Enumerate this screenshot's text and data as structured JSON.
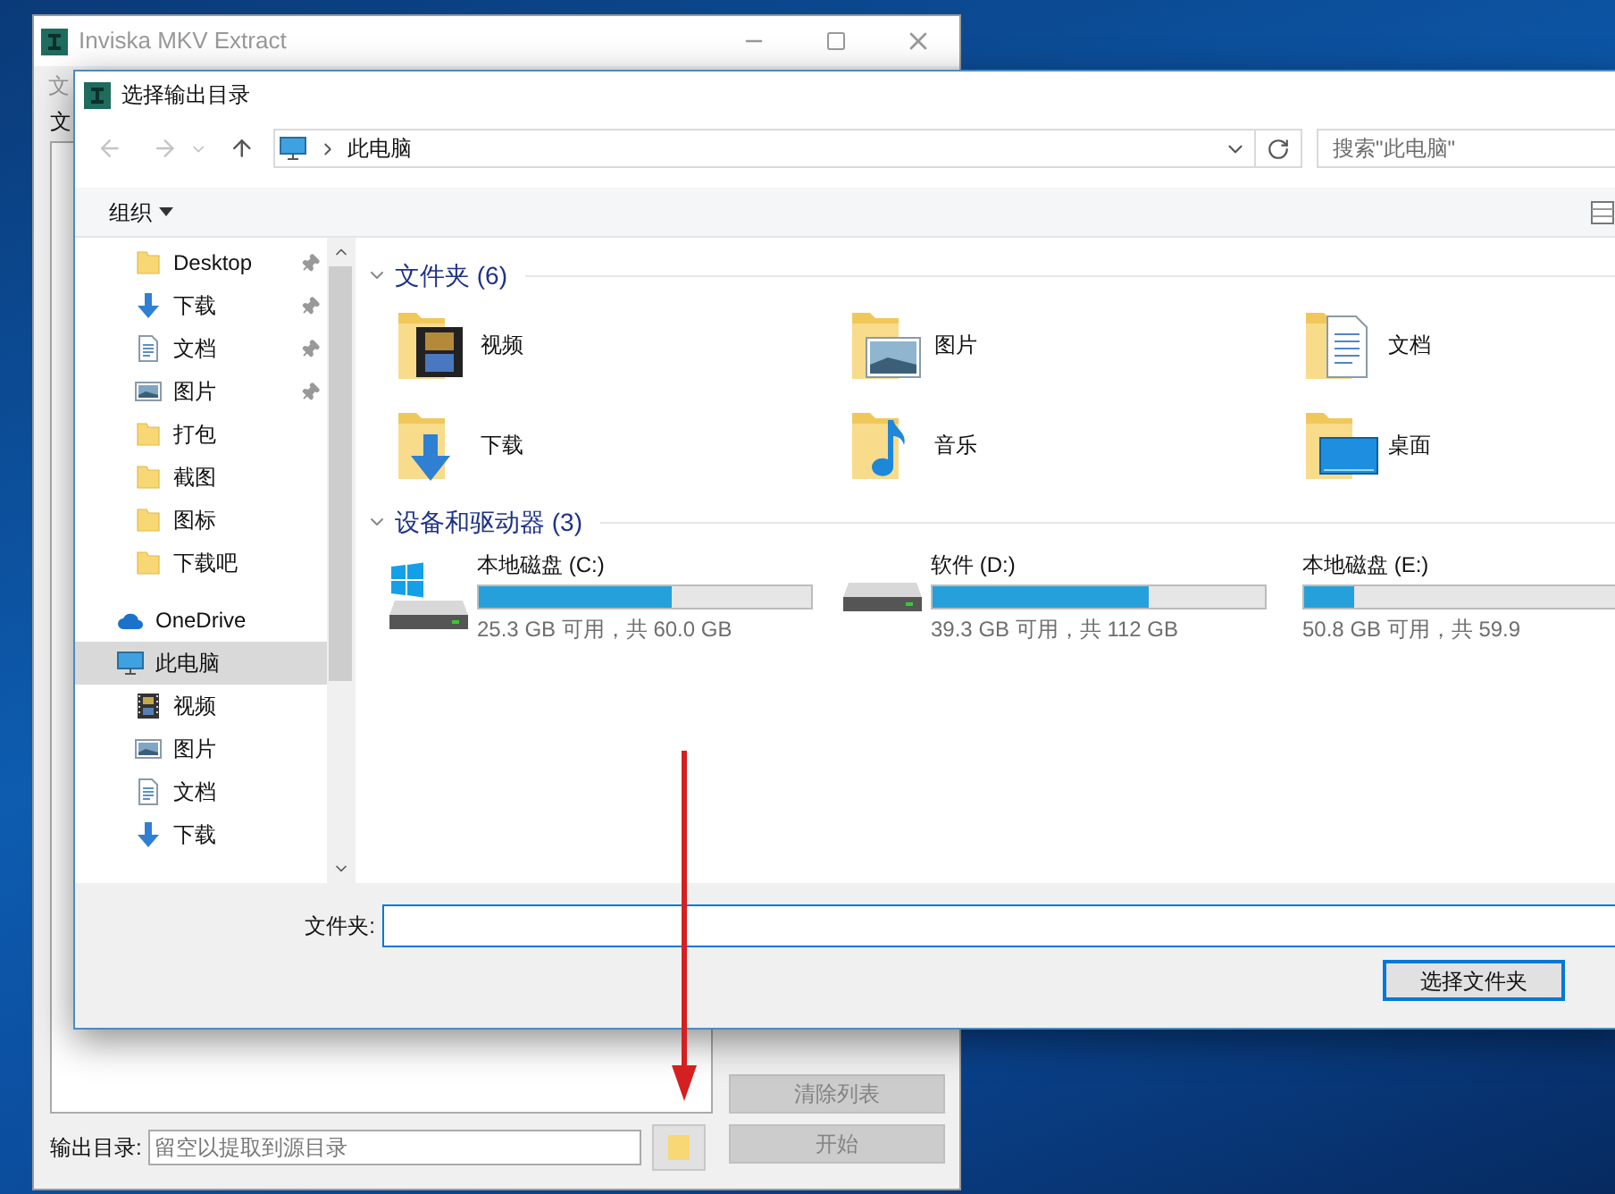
{
  "back_window": {
    "title": "Inviska MKV Extract",
    "menu": [
      {
        "label": "文"
      }
    ],
    "files_label": "文",
    "clear_button": {
      "label": "清除列表",
      "disabled": true
    },
    "start_button": {
      "label": "开始",
      "disabled": true
    },
    "output": {
      "label": "输出目录:",
      "placeholder": "留空以提取到源目录"
    }
  },
  "dialog": {
    "title": "选择输出目录",
    "address": {
      "path": [
        "此电脑"
      ]
    },
    "search": {
      "placeholder": "搜索\"此电脑\""
    },
    "toolbar": {
      "organize": "组织"
    },
    "quick_access": [
      {
        "label": "Desktop",
        "kind": "folder",
        "pinned": true,
        "selected": false
      },
      {
        "label": "下载",
        "kind": "download",
        "pinned": true,
        "selected": false
      },
      {
        "label": "文档",
        "kind": "document",
        "pinned": true,
        "selected": false
      },
      {
        "label": "图片",
        "kind": "picture",
        "pinned": true,
        "selected": false
      },
      {
        "label": "打包",
        "kind": "folder",
        "pinned": false,
        "selected": false
      },
      {
        "label": "截图",
        "kind": "folder",
        "pinned": false,
        "selected": false
      },
      {
        "label": "图标",
        "kind": "folder",
        "pinned": false,
        "selected": false
      },
      {
        "label": "下载吧",
        "kind": "folder",
        "pinned": false,
        "selected": false
      }
    ],
    "roots": [
      {
        "label": "OneDrive",
        "kind": "cloud",
        "selected": false
      },
      {
        "label": "此电脑",
        "kind": "pc",
        "selected": true,
        "children": [
          {
            "label": "视频",
            "kind": "video",
            "selected": false
          },
          {
            "label": "图片",
            "kind": "picture",
            "selected": false
          },
          {
            "label": "文档",
            "kind": "document",
            "selected": false
          },
          {
            "label": "下载",
            "kind": "download",
            "selected": false
          }
        ]
      }
    ],
    "groups": [
      {
        "kind": "folders",
        "title": "文件夹 (6)",
        "expanded": true,
        "items": [
          {
            "label": "视频",
            "kind": "video"
          },
          {
            "label": "图片",
            "kind": "picture"
          },
          {
            "label": "文档",
            "kind": "document"
          },
          {
            "label": "下载",
            "kind": "download"
          },
          {
            "label": "音乐",
            "kind": "music"
          },
          {
            "label": "桌面",
            "kind": "desktop"
          }
        ]
      },
      {
        "kind": "drives",
        "title": "设备和驱动器 (3)",
        "expanded": true,
        "items": [
          {
            "label": "本地磁盘 (C:)",
            "kind": "system",
            "level": 0.58,
            "free": "25.3 GB 可用，共 60.0 GB"
          },
          {
            "label": "软件 (D:)",
            "kind": "disk",
            "level": 0.65,
            "free": "39.3 GB 可用，共 112 GB"
          },
          {
            "label": "本地磁盘 (E:)",
            "kind": "disk",
            "level": 0.15,
            "free": "50.8 GB 可用，共 59.9"
          }
        ]
      }
    ],
    "folder_field": {
      "label": "文件夹:"
    },
    "buttons": [
      {
        "label": "选择文件夹"
      }
    ]
  }
}
